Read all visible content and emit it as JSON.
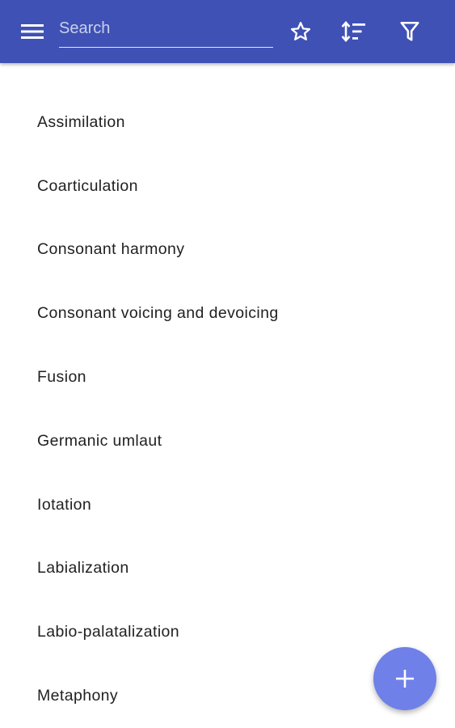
{
  "appbar": {
    "background_color": "#3f51b5",
    "menu_icon": "hamburger-menu-icon",
    "search": {
      "placeholder": "Search",
      "value": ""
    },
    "actions": [
      {
        "icon": "star-outline-icon"
      },
      {
        "icon": "sort-icon"
      },
      {
        "icon": "filter-icon"
      }
    ]
  },
  "list": {
    "items": [
      {
        "label": "Assimilation"
      },
      {
        "label": "Coarticulation"
      },
      {
        "label": "Consonant harmony"
      },
      {
        "label": "Consonant voicing and devoicing"
      },
      {
        "label": "Fusion"
      },
      {
        "label": "Germanic umlaut"
      },
      {
        "label": "Iotation"
      },
      {
        "label": "Labialization"
      },
      {
        "label": "Labio-palatalization"
      },
      {
        "label": "Metaphony"
      }
    ]
  },
  "fab": {
    "icon": "plus-icon",
    "color": "#6f80e8"
  }
}
